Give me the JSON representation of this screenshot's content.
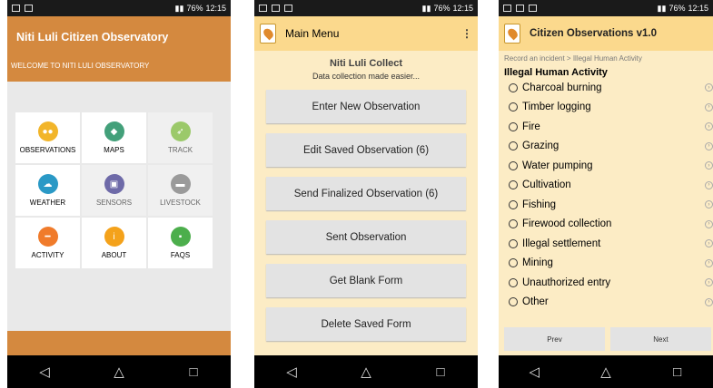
{
  "status": {
    "time": "12:15",
    "battery": "76%"
  },
  "phone1": {
    "title": "Niti Luli Citizen Observatory",
    "welcome": "WELCOME TO NITI LULI OBSERVATORY",
    "tiles": [
      {
        "label": "OBSERVATIONS",
        "icon": "binoculars-icon",
        "color": "#f2b52a",
        "enabled": true
      },
      {
        "label": "MAPS",
        "icon": "map-icon",
        "color": "#43a07a",
        "enabled": true
      },
      {
        "label": "TRACK",
        "icon": "track-icon",
        "color": "#9bc96a",
        "enabled": false
      },
      {
        "label": "WEATHER",
        "icon": "weather-icon",
        "color": "#2a99c6",
        "enabled": true
      },
      {
        "label": "SENSORS",
        "icon": "sensor-icon",
        "color": "#6e6aa8",
        "enabled": false
      },
      {
        "label": "LIVESTOCK",
        "icon": "livestock-icon",
        "color": "#9a9a9a",
        "enabled": false
      },
      {
        "label": "ACTIVITY",
        "icon": "activity-icon",
        "color": "#f07b2b",
        "enabled": true
      },
      {
        "label": "ABOUT",
        "icon": "info-icon",
        "color": "#f4a21b",
        "enabled": true
      },
      {
        "label": "FAQS",
        "icon": "faq-icon",
        "color": "#4cae4c",
        "enabled": true
      }
    ]
  },
  "phone2": {
    "header_title": "Main Menu",
    "app_name": "Niti Luli Collect",
    "tagline": "Data collection made easier...",
    "buttons": [
      "Enter New Observation",
      "Edit Saved Observation (6)",
      "Send Finalized Observation (6)",
      "Sent Observation",
      "Get Blank Form",
      "Delete Saved Form"
    ]
  },
  "phone3": {
    "header_title": "Citizen Observations v1.0",
    "breadcrumb": "Record an incident > Illegal Human Activity",
    "question": "Illegal Human Activity",
    "options": [
      "Charcoal burning",
      "Timber logging",
      "Fire",
      "Grazing",
      "Water pumping",
      "Cultivation",
      "Fishing",
      "Firewood collection",
      "Illegal settlement",
      "Mining",
      "Unauthorized entry",
      "Other"
    ],
    "prev_label": "Prev",
    "next_label": "Next"
  },
  "navbar": {
    "back": "◁",
    "home": "△",
    "recents": "□"
  }
}
